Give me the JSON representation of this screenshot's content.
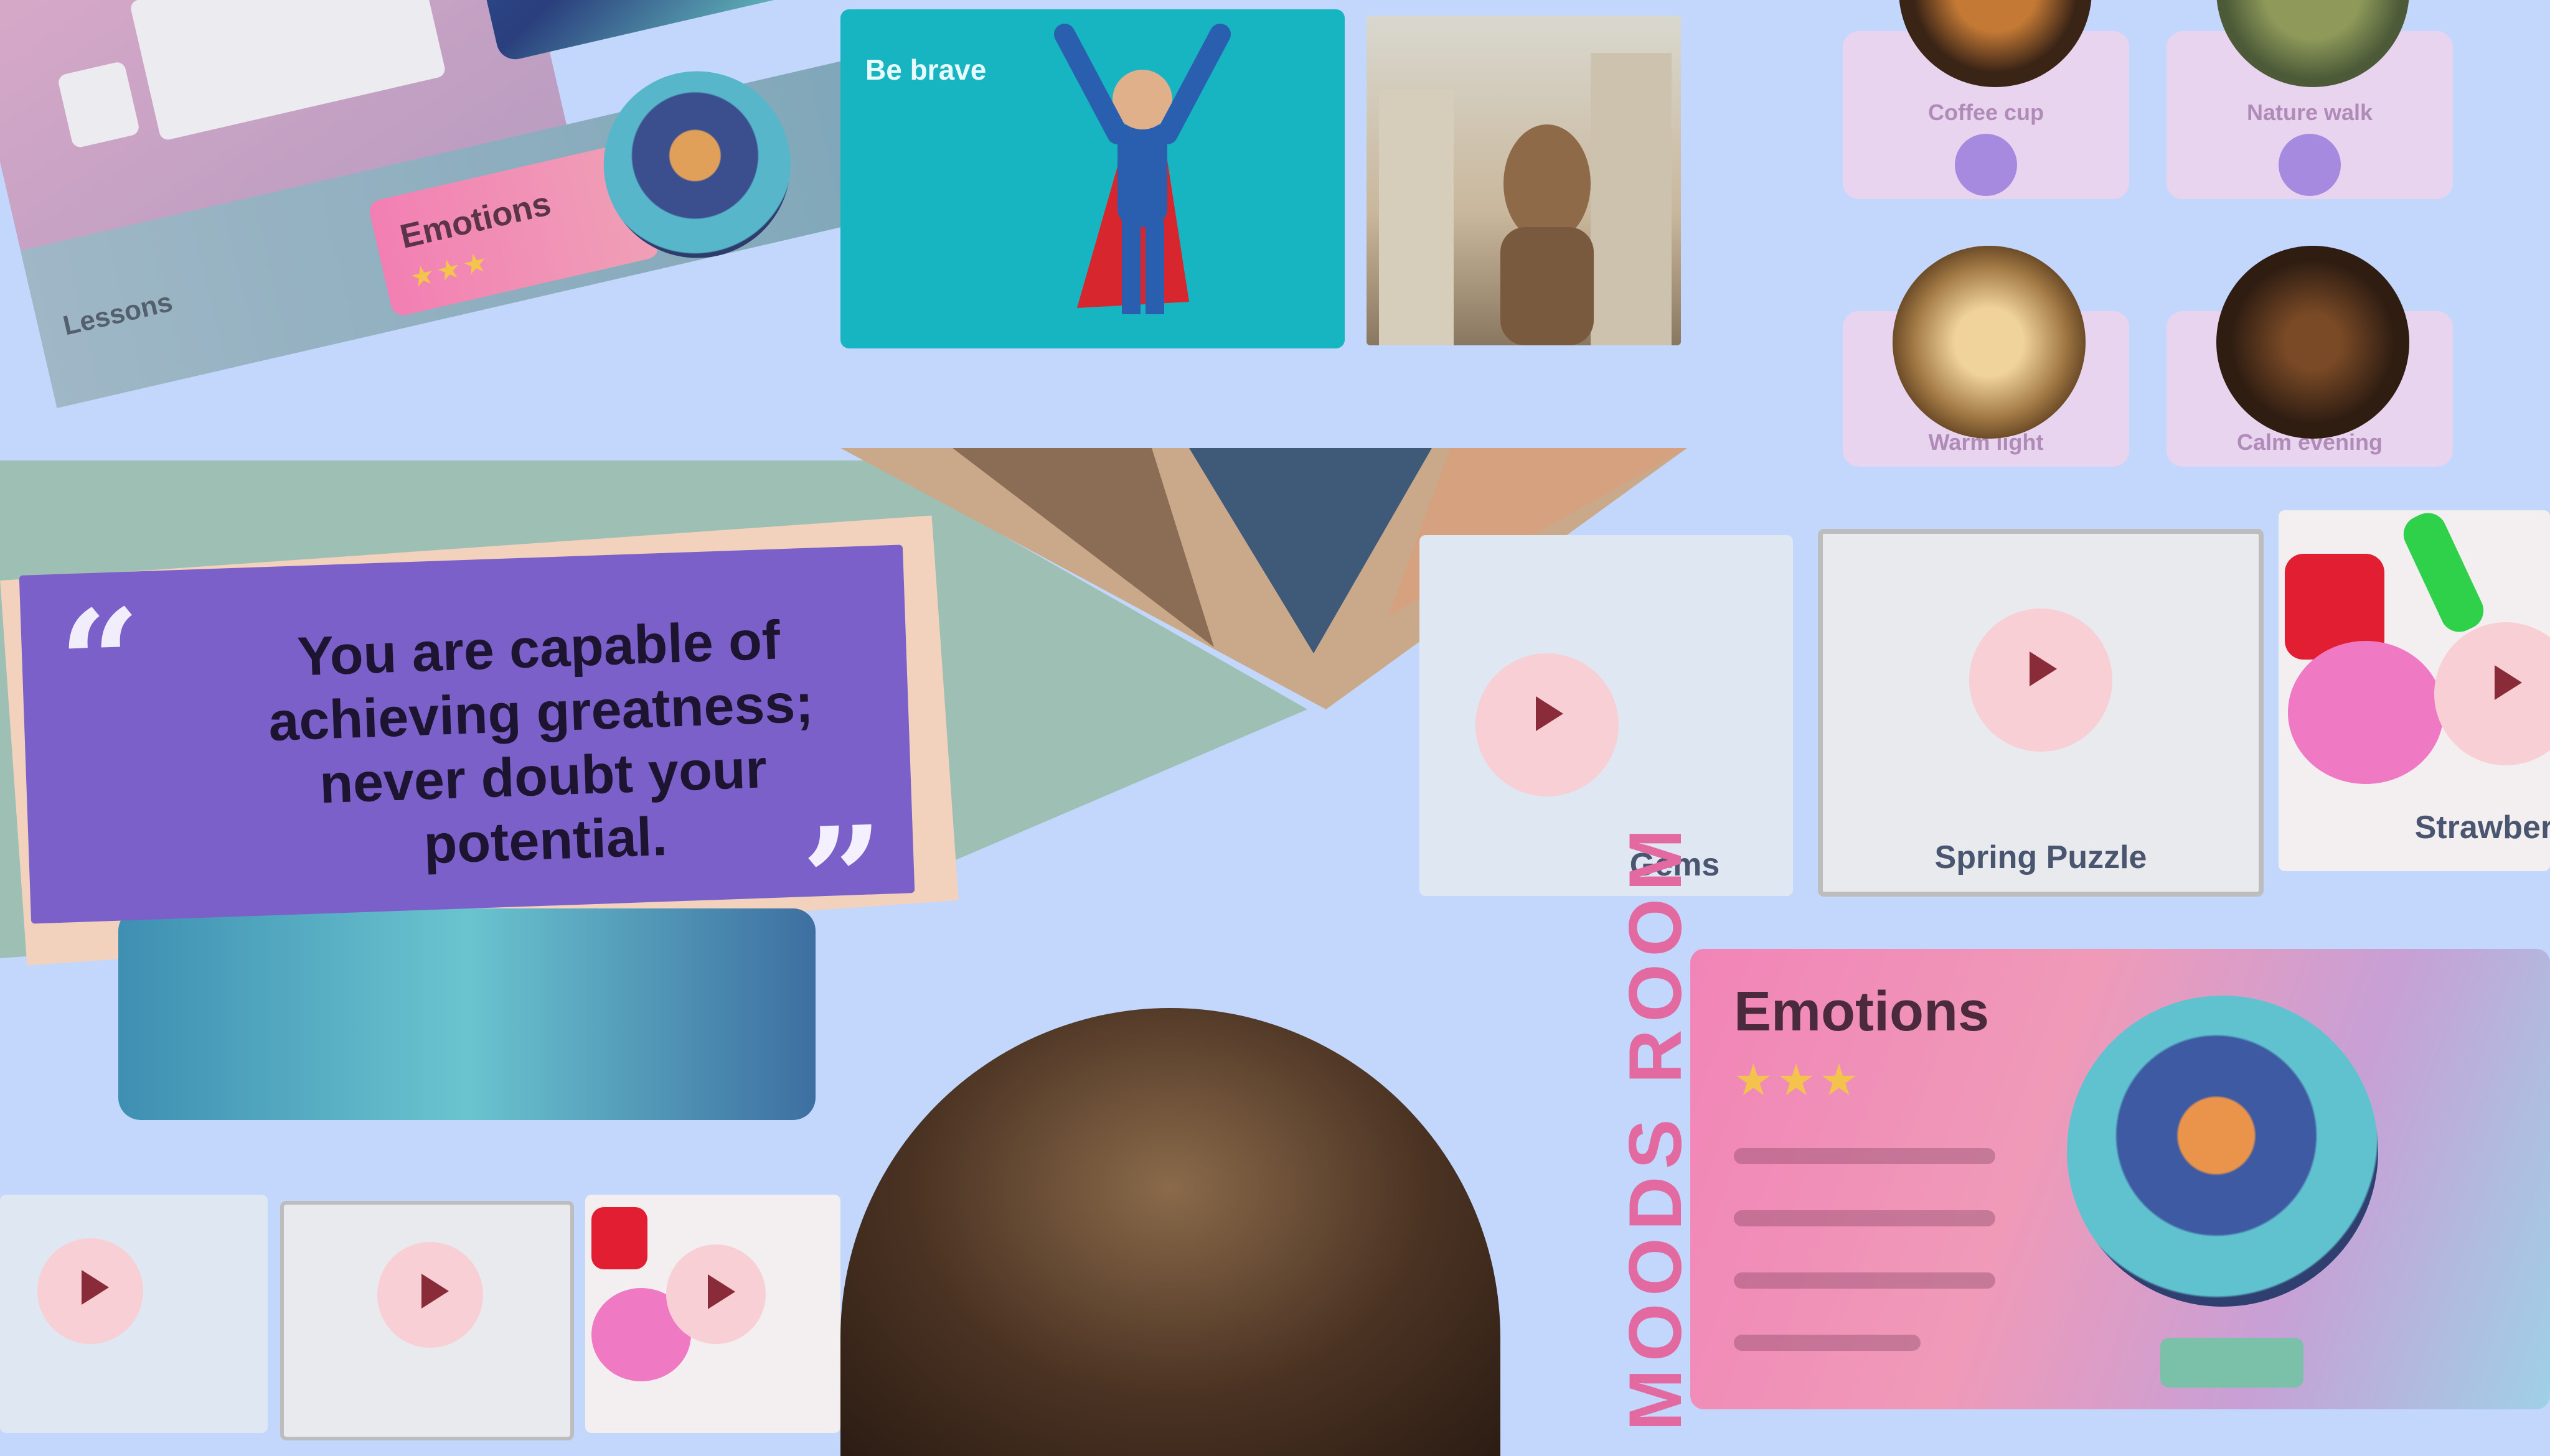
{
  "tilted_collage": {
    "pink_card_title": "Emotions",
    "pink_card_stars": "★★★",
    "label": "Lessons"
  },
  "hero_card": {
    "title": "Be brave"
  },
  "avatars": [
    {
      "label": "Coffee cup"
    },
    {
      "label": "Nature walk"
    },
    {
      "label": "Warm light"
    },
    {
      "label": "Calm evening"
    }
  ],
  "quote": {
    "open_mark": "“",
    "close_mark": "”",
    "text": "You are capable of achieving greatness; never doubt your potential."
  },
  "videos": {
    "row_right": [
      {
        "label": "Gems"
      },
      {
        "label": "Spring Puzzle"
      },
      {
        "label": "Strawberr"
      }
    ],
    "row_bottom": [
      {
        "label": ""
      },
      {
        "label": ""
      },
      {
        "label": ""
      }
    ]
  },
  "vertical_title": "MOODS ROOM",
  "emotions_card": {
    "title": "Emotions",
    "stars": "★★★"
  },
  "colors": {
    "background": "#c2d7fb",
    "quote_purple": "#7b60c9",
    "accent_pink": "#e36aa0",
    "teal": "#17b4c2"
  }
}
